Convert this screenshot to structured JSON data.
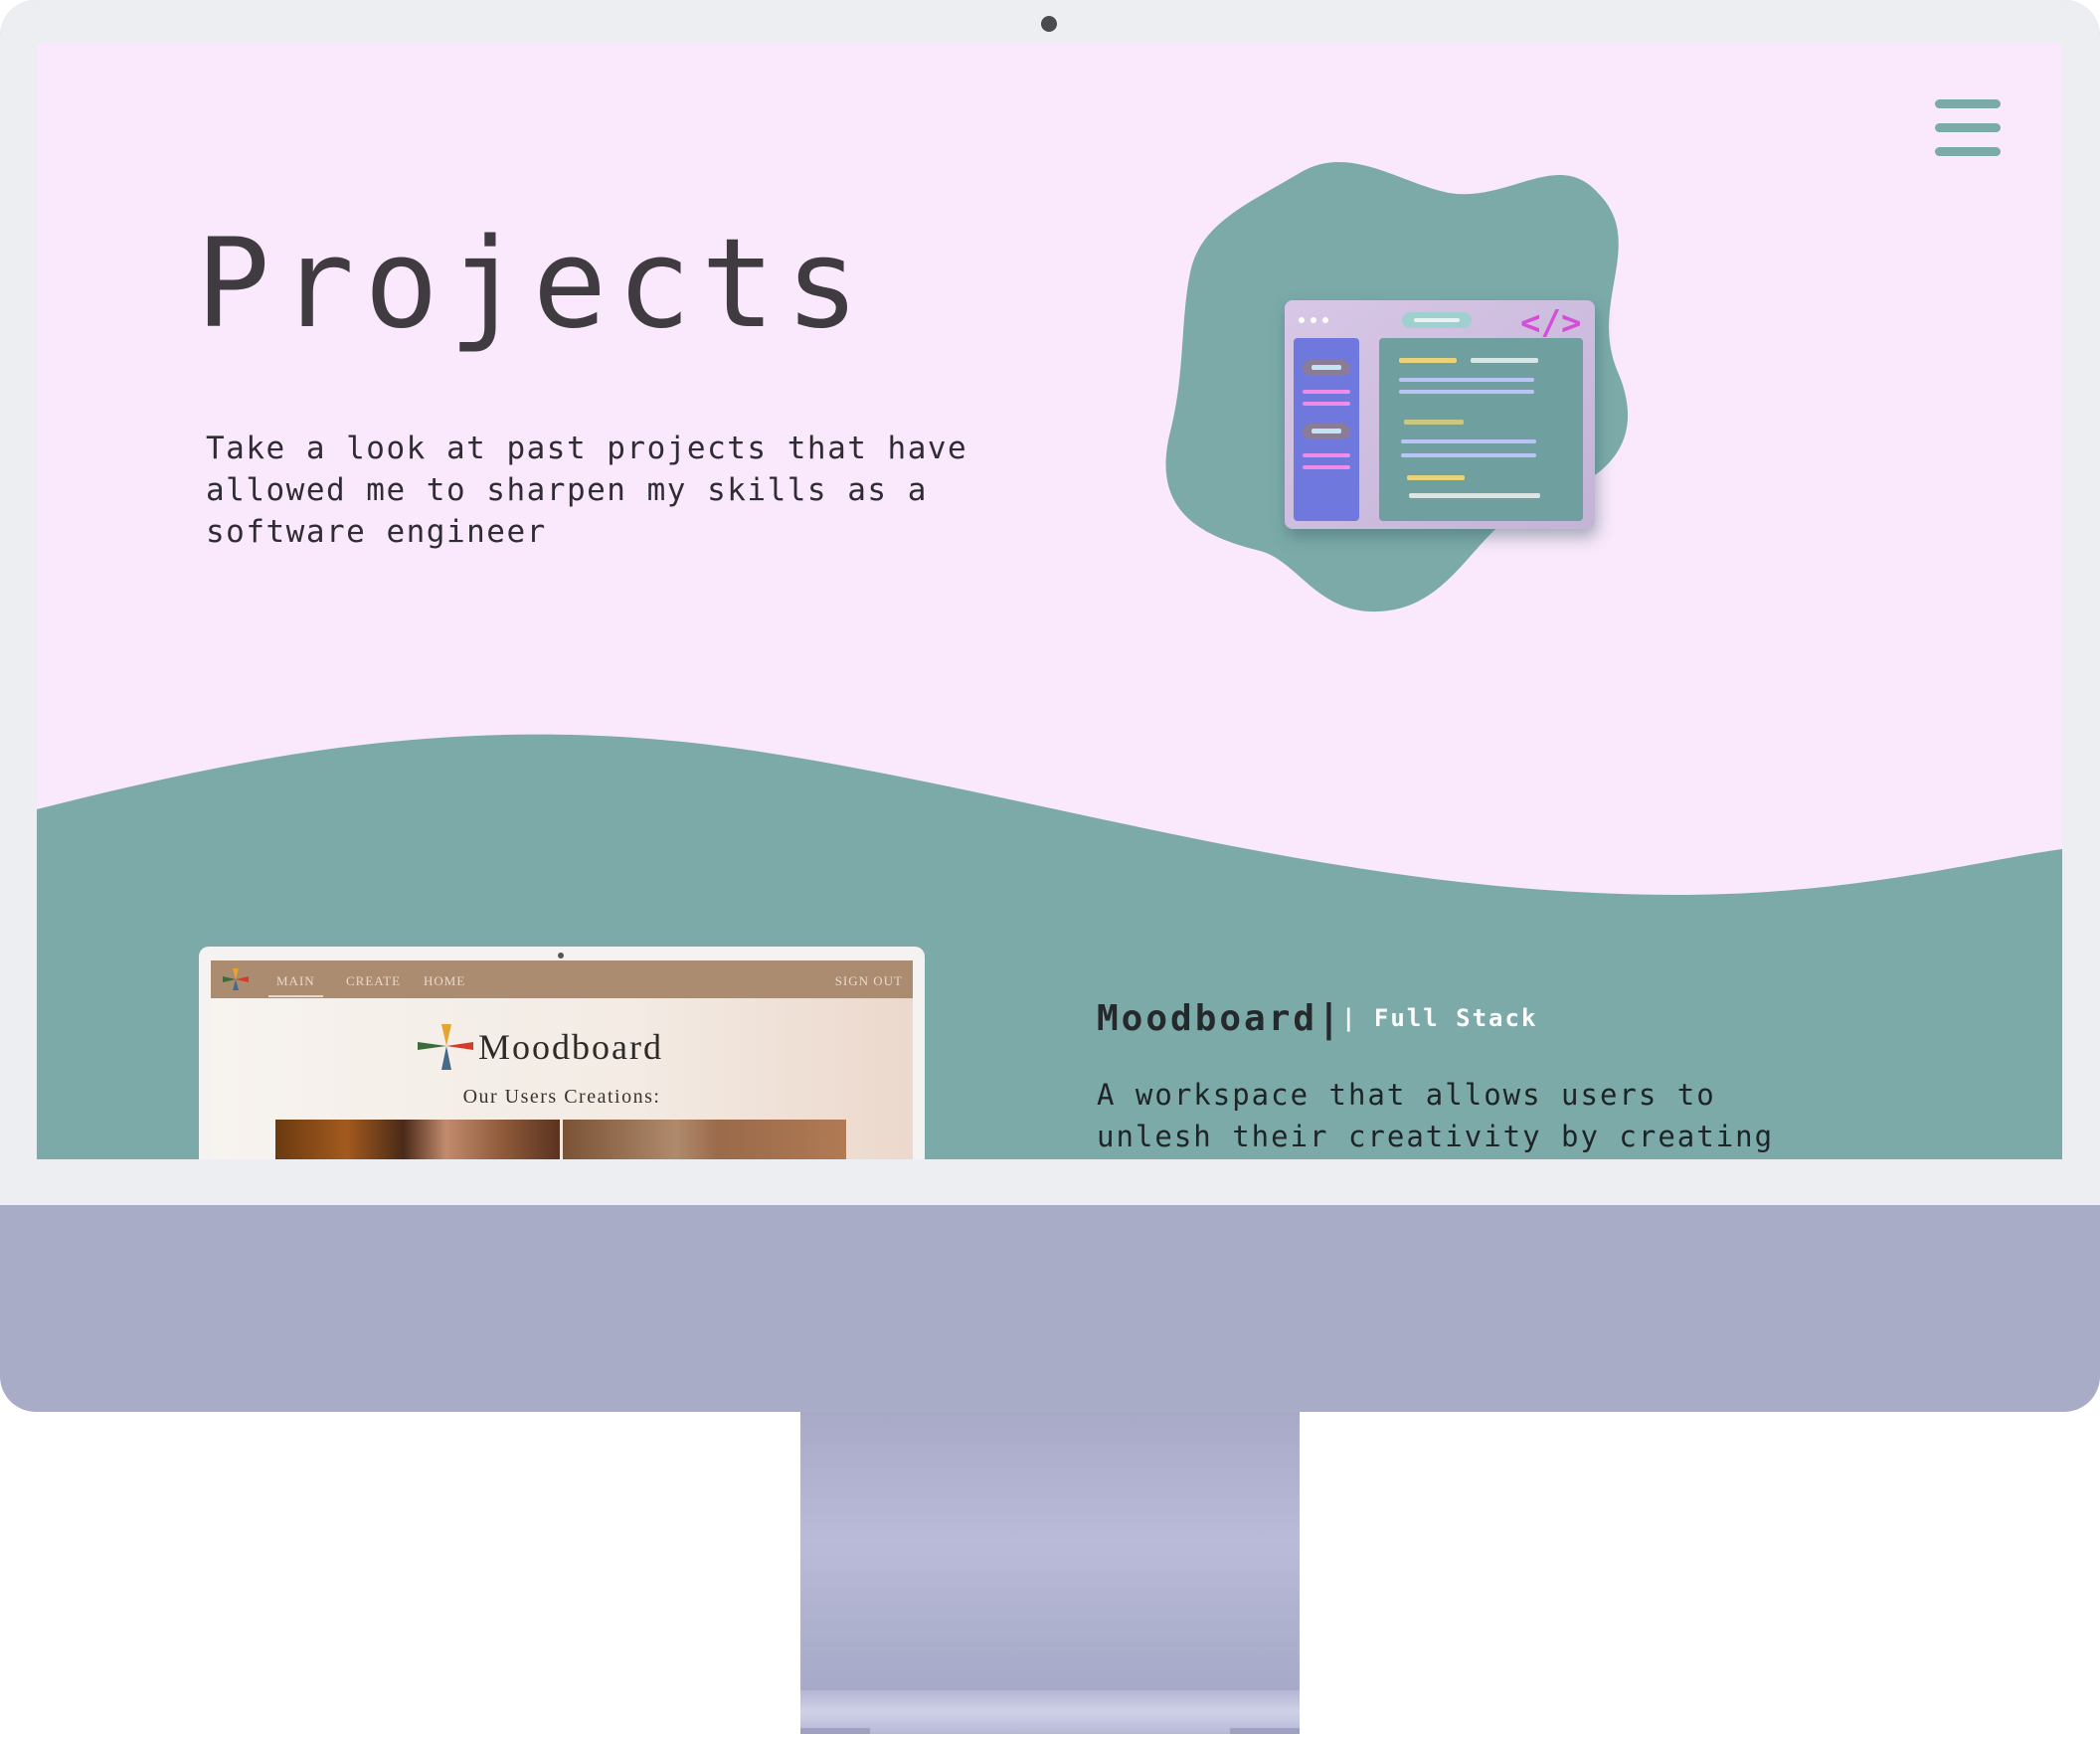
{
  "header": {
    "menu_icon": "hamburger-menu-icon"
  },
  "hero": {
    "title": "Projects",
    "intro": "Take a look at past projects that have\nallowed me to sharpen my skills as a\nsoftware engineer",
    "illustration_icon": "code-editor-illustration"
  },
  "project": {
    "name": "Moodboard",
    "separator": "|",
    "tag": "| Full Stack",
    "description": "A workspace that allows users to\nunlesh their creativity by creating\nmood boards. Users can utilize images"
  },
  "preview": {
    "nav": [
      "MAIN",
      "CREATE",
      "HOME"
    ],
    "nav_signout": "SIGN OUT",
    "brand": "Moodboard",
    "subtitle": "Our Users Creations:"
  },
  "colors": {
    "page_background": "#fae8fc",
    "accent_teal": "#7baaa9",
    "monitor_chin": "#a9acc7",
    "bezel": "#eceef1"
  }
}
